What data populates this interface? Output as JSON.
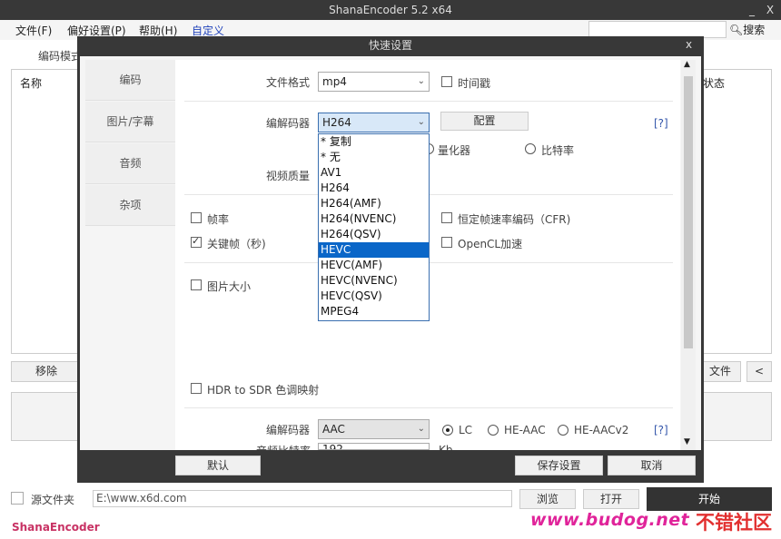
{
  "window": {
    "title": "ShanaEncoder 5.2 x64",
    "minimize": "_",
    "close": "X"
  },
  "menu": [
    "文件(F)",
    "偏好设置(P)",
    "帮助(H)",
    "自定义"
  ],
  "search": {
    "label": "搜索",
    "value": ""
  },
  "main": {
    "encode_tab": "编码模式",
    "col_name": "名称",
    "col_status": "状态",
    "remove_btn": "移除",
    "file_btn": "文件",
    "collapse_btn": "<",
    "source_label": "源文件夹",
    "source_path": "E:\\www.x6d.com",
    "browse_btn": "浏览",
    "open_btn": "打开",
    "start_btn": "开始",
    "brand": "ShanaEncoder",
    "watermark": "www.budog.net",
    "watermark2": "不错社区"
  },
  "dialog": {
    "title": "快速设置",
    "close": "x",
    "nav": [
      "编码",
      "图片/字幕",
      "音频",
      "杂项"
    ],
    "format_label": "文件格式",
    "format_value": "mp4",
    "timestamp_label": "时间戳",
    "codec_label": "编解码器",
    "codec_value": "H264",
    "config_btn": "配置",
    "help": "[?]",
    "quantizer_label": "量化器",
    "bitrate_label": "比特率",
    "quality_label": "视频质量",
    "framerate_label": "帧率",
    "cfr_label": "恒定帧速率编码（CFR)",
    "keyframe_label": "关键帧（秒)",
    "opencl_label": "OpenCL加速",
    "picsize_label": "图片大小",
    "hdr_label": "HDR to SDR 色调映射",
    "audio_codec_label": "编解码器",
    "audio_codec_value": "AAC",
    "lc_label": "LC",
    "heaac_label": "HE-AAC",
    "heaacv2_label": "HE-AACv2",
    "audio_bitrate_label": "音频比特率",
    "audio_bitrate_value": "192",
    "audio_bitrate_unit": "Kb",
    "default_btn": "默认",
    "save_btn": "保存设置",
    "cancel_btn": "取消",
    "codec_options": [
      "* 复制",
      "* 无",
      "AV1",
      "H264",
      "H264(AMF)",
      "H264(NVENC)",
      "H264(QSV)",
      "HEVC",
      "HEVC(AMF)",
      "HEVC(NVENC)",
      "HEVC(QSV)",
      "MPEG4"
    ]
  }
}
